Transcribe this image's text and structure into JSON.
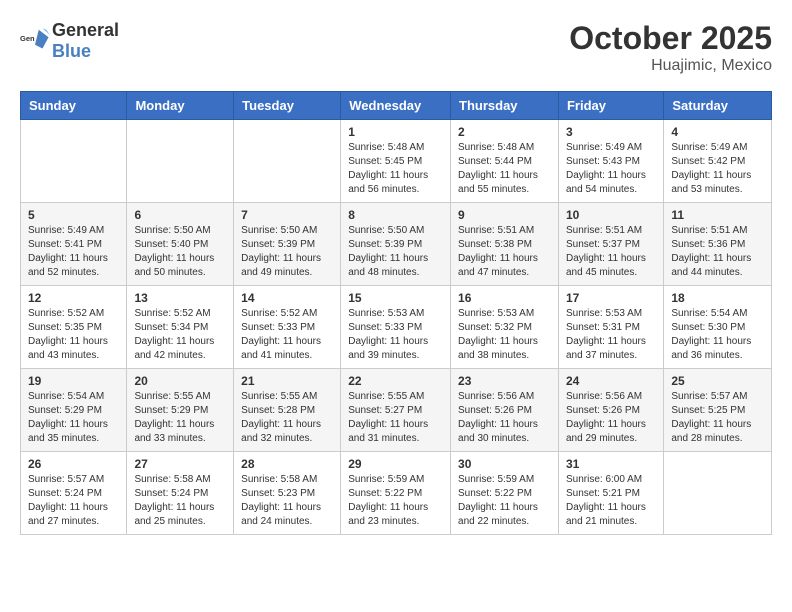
{
  "header": {
    "logo_general": "General",
    "logo_blue": "Blue",
    "month": "October 2025",
    "location": "Huajimic, Mexico"
  },
  "weekdays": [
    "Sunday",
    "Monday",
    "Tuesday",
    "Wednesday",
    "Thursday",
    "Friday",
    "Saturday"
  ],
  "weeks": [
    [
      {
        "day": "",
        "info": ""
      },
      {
        "day": "",
        "info": ""
      },
      {
        "day": "",
        "info": ""
      },
      {
        "day": "1",
        "info": "Sunrise: 5:48 AM\nSunset: 5:45 PM\nDaylight: 11 hours and 56 minutes."
      },
      {
        "day": "2",
        "info": "Sunrise: 5:48 AM\nSunset: 5:44 PM\nDaylight: 11 hours and 55 minutes."
      },
      {
        "day": "3",
        "info": "Sunrise: 5:49 AM\nSunset: 5:43 PM\nDaylight: 11 hours and 54 minutes."
      },
      {
        "day": "4",
        "info": "Sunrise: 5:49 AM\nSunset: 5:42 PM\nDaylight: 11 hours and 53 minutes."
      }
    ],
    [
      {
        "day": "5",
        "info": "Sunrise: 5:49 AM\nSunset: 5:41 PM\nDaylight: 11 hours and 52 minutes."
      },
      {
        "day": "6",
        "info": "Sunrise: 5:50 AM\nSunset: 5:40 PM\nDaylight: 11 hours and 50 minutes."
      },
      {
        "day": "7",
        "info": "Sunrise: 5:50 AM\nSunset: 5:39 PM\nDaylight: 11 hours and 49 minutes."
      },
      {
        "day": "8",
        "info": "Sunrise: 5:50 AM\nSunset: 5:39 PM\nDaylight: 11 hours and 48 minutes."
      },
      {
        "day": "9",
        "info": "Sunrise: 5:51 AM\nSunset: 5:38 PM\nDaylight: 11 hours and 47 minutes."
      },
      {
        "day": "10",
        "info": "Sunrise: 5:51 AM\nSunset: 5:37 PM\nDaylight: 11 hours and 45 minutes."
      },
      {
        "day": "11",
        "info": "Sunrise: 5:51 AM\nSunset: 5:36 PM\nDaylight: 11 hours and 44 minutes."
      }
    ],
    [
      {
        "day": "12",
        "info": "Sunrise: 5:52 AM\nSunset: 5:35 PM\nDaylight: 11 hours and 43 minutes."
      },
      {
        "day": "13",
        "info": "Sunrise: 5:52 AM\nSunset: 5:34 PM\nDaylight: 11 hours and 42 minutes."
      },
      {
        "day": "14",
        "info": "Sunrise: 5:52 AM\nSunset: 5:33 PM\nDaylight: 11 hours and 41 minutes."
      },
      {
        "day": "15",
        "info": "Sunrise: 5:53 AM\nSunset: 5:33 PM\nDaylight: 11 hours and 39 minutes."
      },
      {
        "day": "16",
        "info": "Sunrise: 5:53 AM\nSunset: 5:32 PM\nDaylight: 11 hours and 38 minutes."
      },
      {
        "day": "17",
        "info": "Sunrise: 5:53 AM\nSunset: 5:31 PM\nDaylight: 11 hours and 37 minutes."
      },
      {
        "day": "18",
        "info": "Sunrise: 5:54 AM\nSunset: 5:30 PM\nDaylight: 11 hours and 36 minutes."
      }
    ],
    [
      {
        "day": "19",
        "info": "Sunrise: 5:54 AM\nSunset: 5:29 PM\nDaylight: 11 hours and 35 minutes."
      },
      {
        "day": "20",
        "info": "Sunrise: 5:55 AM\nSunset: 5:29 PM\nDaylight: 11 hours and 33 minutes."
      },
      {
        "day": "21",
        "info": "Sunrise: 5:55 AM\nSunset: 5:28 PM\nDaylight: 11 hours and 32 minutes."
      },
      {
        "day": "22",
        "info": "Sunrise: 5:55 AM\nSunset: 5:27 PM\nDaylight: 11 hours and 31 minutes."
      },
      {
        "day": "23",
        "info": "Sunrise: 5:56 AM\nSunset: 5:26 PM\nDaylight: 11 hours and 30 minutes."
      },
      {
        "day": "24",
        "info": "Sunrise: 5:56 AM\nSunset: 5:26 PM\nDaylight: 11 hours and 29 minutes."
      },
      {
        "day": "25",
        "info": "Sunrise: 5:57 AM\nSunset: 5:25 PM\nDaylight: 11 hours and 28 minutes."
      }
    ],
    [
      {
        "day": "26",
        "info": "Sunrise: 5:57 AM\nSunset: 5:24 PM\nDaylight: 11 hours and 27 minutes."
      },
      {
        "day": "27",
        "info": "Sunrise: 5:58 AM\nSunset: 5:24 PM\nDaylight: 11 hours and 25 minutes."
      },
      {
        "day": "28",
        "info": "Sunrise: 5:58 AM\nSunset: 5:23 PM\nDaylight: 11 hours and 24 minutes."
      },
      {
        "day": "29",
        "info": "Sunrise: 5:59 AM\nSunset: 5:22 PM\nDaylight: 11 hours and 23 minutes."
      },
      {
        "day": "30",
        "info": "Sunrise: 5:59 AM\nSunset: 5:22 PM\nDaylight: 11 hours and 22 minutes."
      },
      {
        "day": "31",
        "info": "Sunrise: 6:00 AM\nSunset: 5:21 PM\nDaylight: 11 hours and 21 minutes."
      },
      {
        "day": "",
        "info": ""
      }
    ]
  ]
}
